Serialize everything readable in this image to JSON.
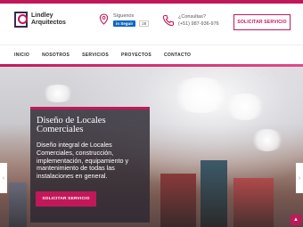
{
  "header": {
    "logo_line1": "Lindley",
    "logo_line2": "Arquitectos",
    "follow_label": "Síguenos",
    "linkedin_label": "Seguir",
    "linkedin_count": "28",
    "consult_label": "¿Consultas?",
    "phone": "(+51) 987-936-976",
    "cta_label": "SOLICITAR SERVICIO"
  },
  "nav": {
    "items": [
      "INICIO",
      "NOSOTROS",
      "SERVICIOS",
      "PROYECTOS",
      "CONTACTO"
    ]
  },
  "hero": {
    "title": "Diseño de Locales Comerciales",
    "text": "Diseño integral de Locales Comerciales, construcción, implementación, equipamiento y mantenimiento de todas las instalaciones en general.",
    "button_label": "SOLICITAR SERVICIO"
  },
  "colors": {
    "accent": "#c2185b",
    "linkedin": "#0a66c2"
  }
}
